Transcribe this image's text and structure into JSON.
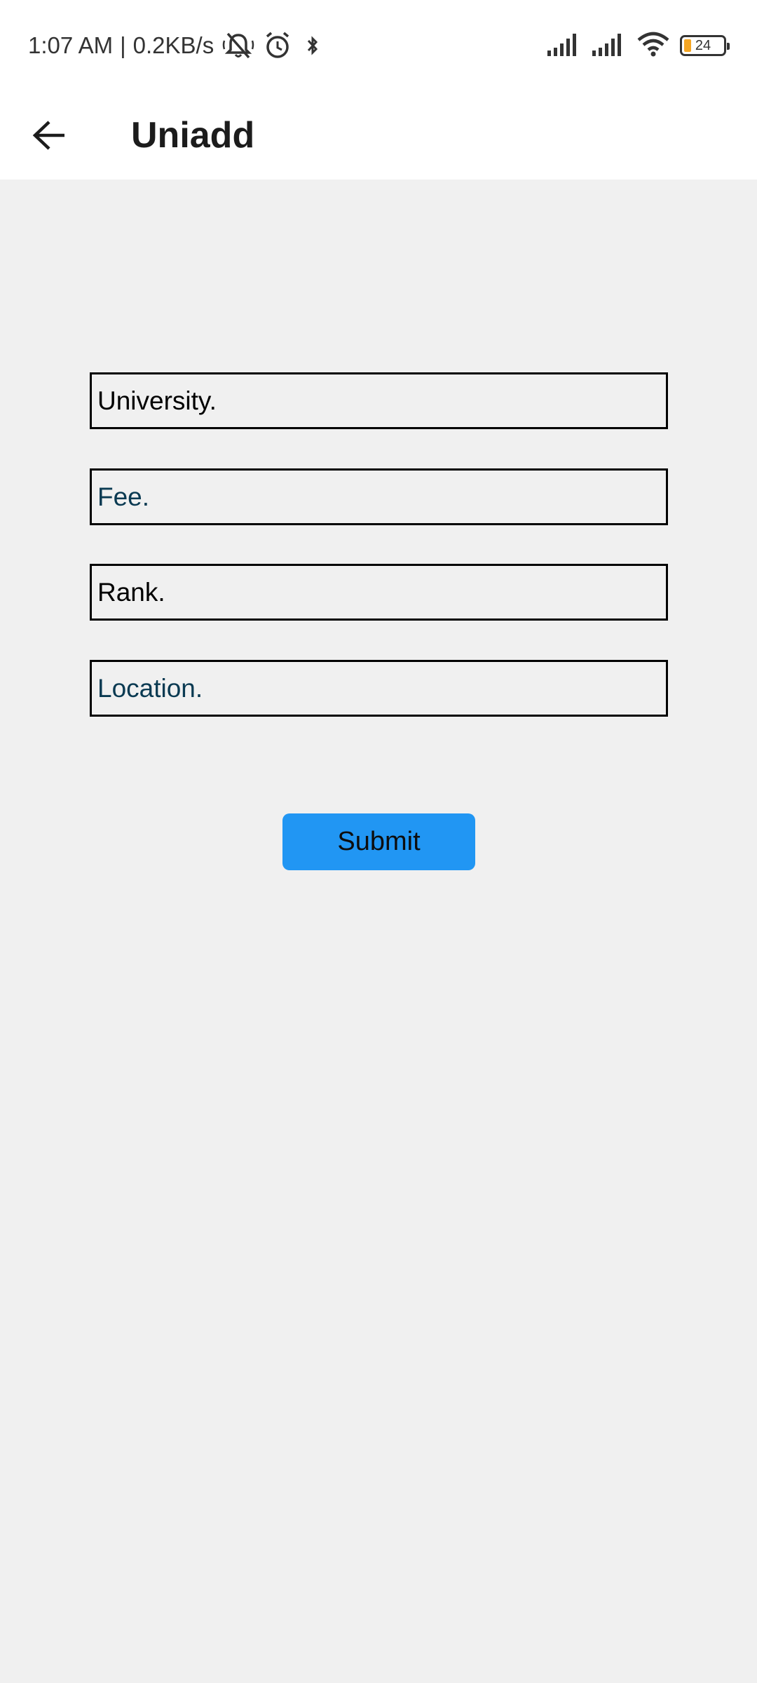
{
  "status_bar": {
    "time": "1:07 AM",
    "network_speed": "0.2KB/s",
    "separator": "|",
    "battery_level": "24",
    "icons": [
      "silent-mode-icon",
      "alarm-icon",
      "bluetooth-icon",
      "signal-icon",
      "signal-icon",
      "wifi-icon",
      "battery-icon"
    ]
  },
  "app_bar": {
    "back_icon": "arrow-left-icon",
    "title": "Uniadd"
  },
  "form": {
    "university": {
      "value": "University.",
      "placeholder": ""
    },
    "fee": {
      "value": "",
      "placeholder": "Fee."
    },
    "rank": {
      "value": "Rank.",
      "placeholder": ""
    },
    "location": {
      "value": "",
      "placeholder": "Location."
    },
    "submit_label": "Submit"
  },
  "colors": {
    "background": "#f0f0f0",
    "bar_background": "#ffffff",
    "accent": "#2196f3",
    "placeholder_text": "#0a3a52",
    "battery_fill": "#f5a623"
  }
}
